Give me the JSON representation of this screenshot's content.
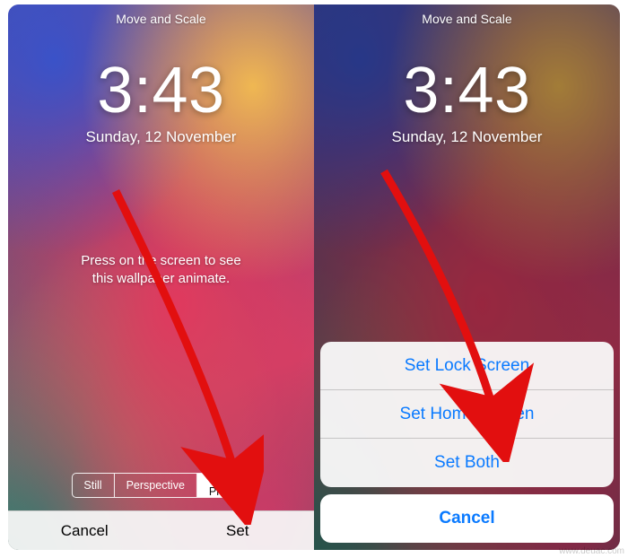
{
  "left": {
    "header": "Move and Scale",
    "time": "3:43",
    "date": "Sunday, 12 November",
    "hint_line1": "Press on the screen to see",
    "hint_line2": "this wallpaper animate.",
    "segments": {
      "still": "Still",
      "perspective": "Perspective",
      "live": "Live Photo"
    },
    "toolbar": {
      "cancel": "Cancel",
      "set": "Set"
    }
  },
  "right": {
    "header": "Move and Scale",
    "time": "3:43",
    "date": "Sunday, 12 November",
    "sheet": {
      "lock": "Set Lock Screen",
      "home": "Set Home Screen",
      "both": "Set Both",
      "cancel": "Cancel"
    }
  },
  "watermark": "www.deuac.com"
}
